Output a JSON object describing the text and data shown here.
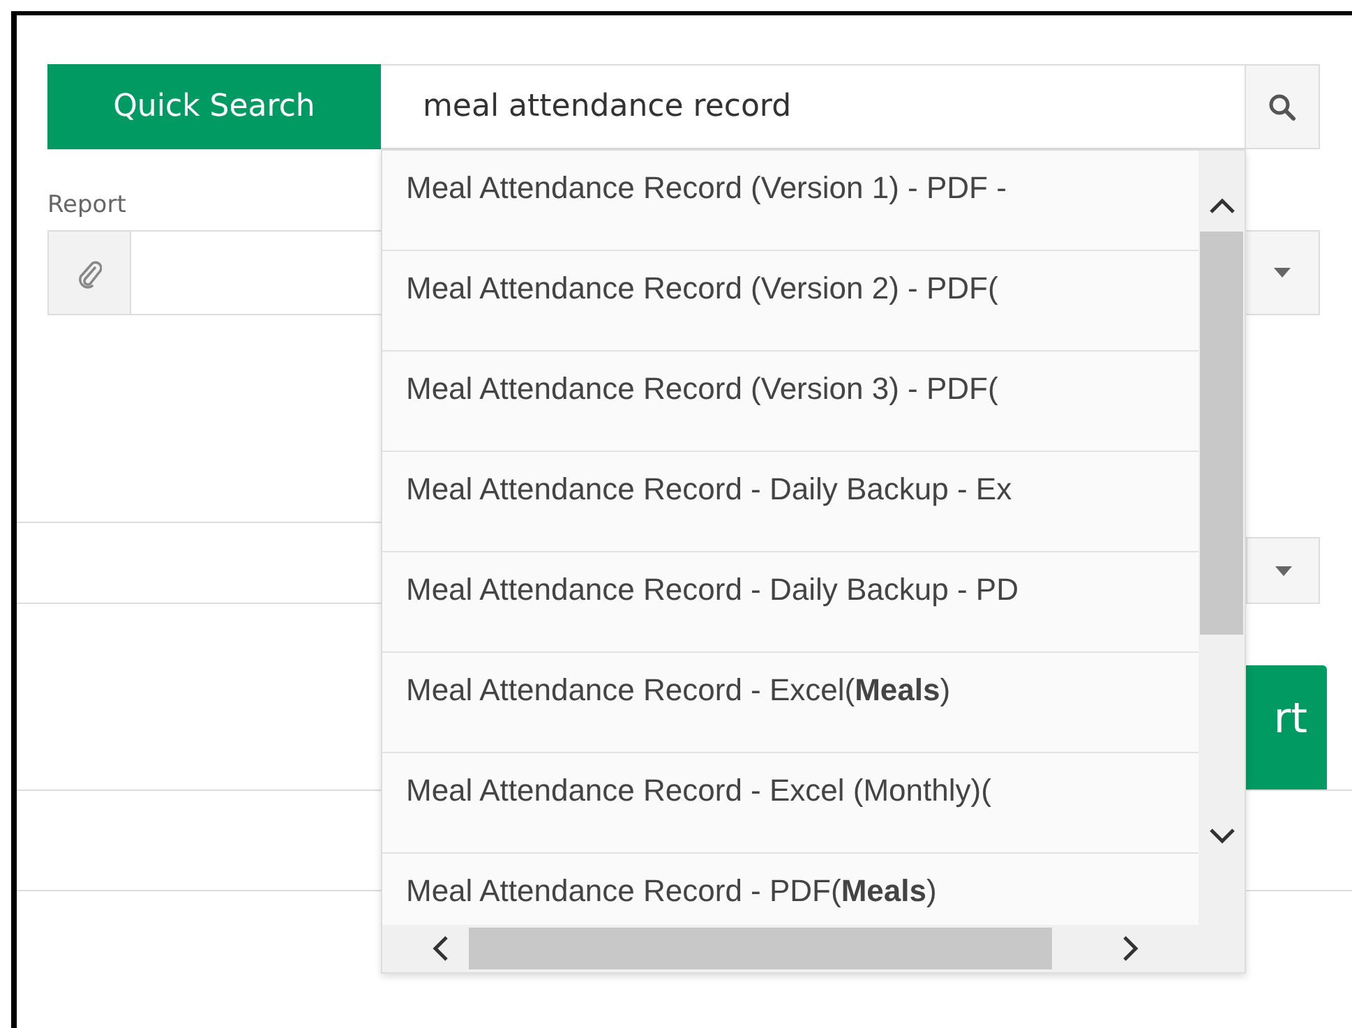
{
  "quick_search": {
    "button": "Quick Search",
    "query": "meal attendance record"
  },
  "report": {
    "label": "Report"
  },
  "suggestions": [
    {
      "text": "Meal Attendance Record (Version 1) - PDF -"
    },
    {
      "text": "Meal Attendance Record (Version 2) - PDF("
    },
    {
      "text": "Meal Attendance Record (Version 3) - PDF("
    },
    {
      "text": "Meal Attendance Record - Daily Backup - Ex"
    },
    {
      "text": "Meal Attendance Record - Daily Backup - PD"
    },
    {
      "text": "Meal Attendance Record - Excel(**Meals**)"
    },
    {
      "text": "Meal Attendance Record - Excel (Monthly)("
    },
    {
      "text": "Meal Attendance Record - PDF(**Meals**)"
    }
  ],
  "action_button": {
    "label": "rt"
  }
}
